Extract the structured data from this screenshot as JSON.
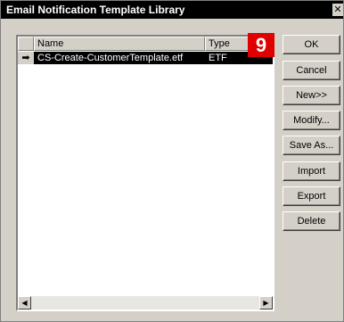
{
  "window": {
    "title": "Email Notification Template Library",
    "close_glyph": "✕"
  },
  "list": {
    "columns": [
      {
        "label": "Name"
      },
      {
        "label": "Type"
      }
    ],
    "rows": [
      {
        "indicator": "➡",
        "name": "CS-Create-CustomerTemplate.etf",
        "type": "ETF",
        "selected": true
      }
    ],
    "scroll_left_glyph": "◀",
    "scroll_right_glyph": "▶"
  },
  "badge": {
    "text": "9",
    "color": "#e00000"
  },
  "buttons": {
    "ok": "OK",
    "cancel": "Cancel",
    "new": "New>>",
    "modify": "Modify...",
    "save_as": "Save As...",
    "import": "Import",
    "export": "Export",
    "delete": "Delete"
  }
}
